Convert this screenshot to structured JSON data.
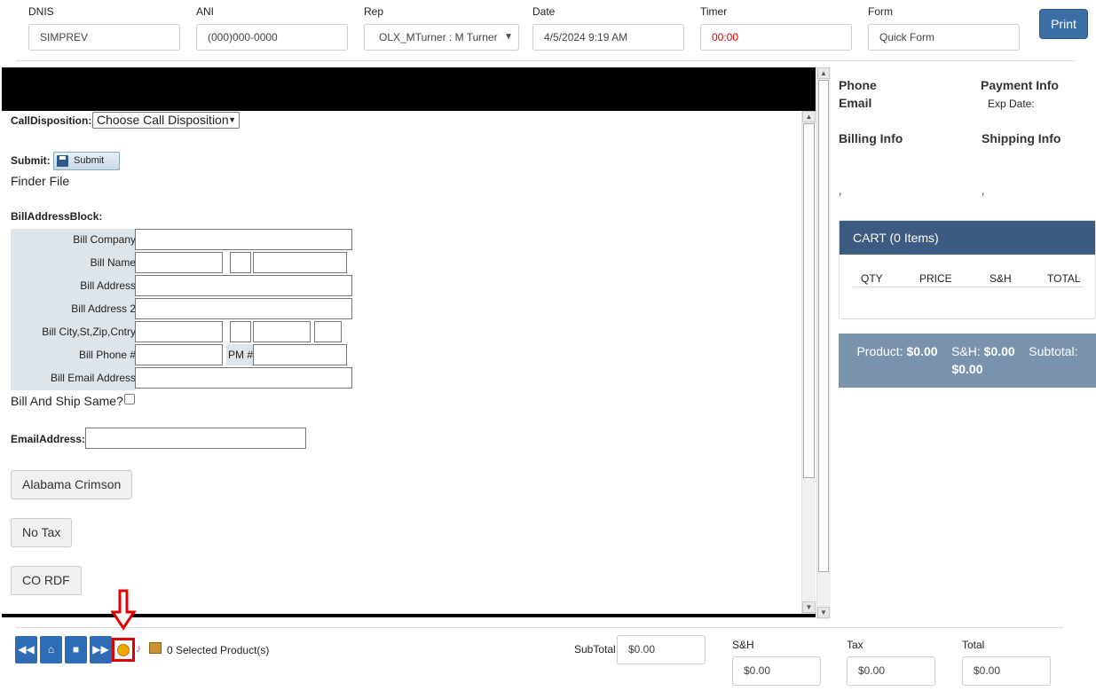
{
  "header": {
    "fields": [
      {
        "label": "DNIS",
        "value": "SIMPREV"
      },
      {
        "label": "ANI",
        "value": "(000)000-0000"
      },
      {
        "label": "Rep",
        "value": "OLX_MTurner : M Turner"
      },
      {
        "label": "Date",
        "value": "4/5/2024 9:19 AM"
      },
      {
        "label": "Timer",
        "value": "00:00"
      },
      {
        "label": "Form",
        "value": "Quick Form"
      }
    ],
    "print_label": "Print",
    "timer_color": "#e00000"
  },
  "form": {
    "call_disposition_label": "CallDisposition",
    "call_disposition_value": "Choose Call Disposition",
    "submit_label": "Submit",
    "submit_button": "Submit",
    "finder_file": "Finder File",
    "bill_block_label": "BillAddressBlock",
    "bill_rows": [
      "Bill Company",
      "Bill Name",
      "Bill Address",
      "Bill Address 2",
      "Bill City,St,Zip,Cntry",
      "Bill Phone #",
      "Bill Email Address"
    ],
    "pm_label": "PM #",
    "bill_ship_same": "Bill And Ship Same?",
    "email_label": "EmailAddress",
    "buttons": [
      "Alabama Crimson",
      "No Tax",
      "CO RDF"
    ]
  },
  "summary": {
    "phone": "Phone",
    "email": "Email",
    "payment_info": "Payment Info",
    "exp_date": "Exp Date:",
    "billing_info": "Billing Info",
    "shipping_info": "Shipping Info",
    "comma": ","
  },
  "cart": {
    "title": "CART (0 Items)",
    "columns": [
      "QTY",
      "PRICE",
      "S&H",
      "TOTAL"
    ],
    "product_label": "Product:",
    "product_value": "$0.00",
    "sh_label": "S&H:",
    "sh_value": "$0.00",
    "subtotal_label": "Subtotal:",
    "subtotal_value": "$0.00"
  },
  "footer": {
    "selected_products": "0 Selected Product(s)",
    "subtotal_label": "SubTotal",
    "subtotal_value": "$0.00",
    "sh_label": "S&H",
    "sh_value": "$0.00",
    "tax_label": "Tax",
    "tax_value": "$0.00",
    "total_label": "Total",
    "total_value": "$0.00"
  }
}
